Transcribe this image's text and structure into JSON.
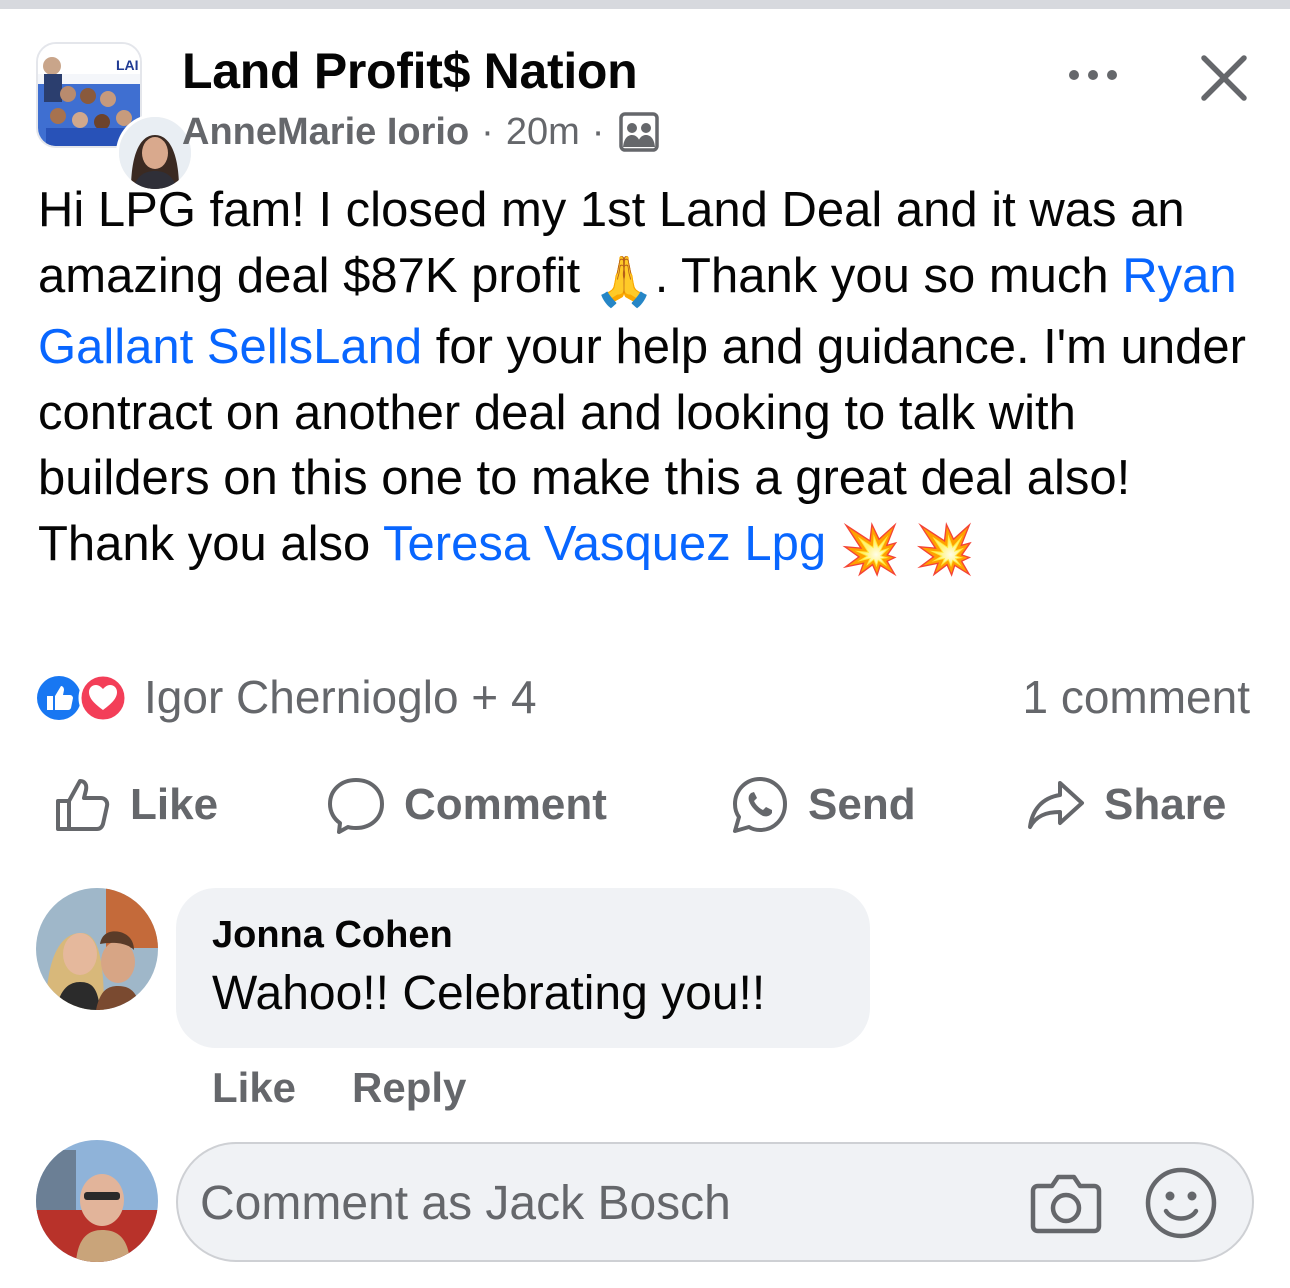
{
  "post": {
    "group_name": "Land Profit$ Nation",
    "author": "AnneMarie Iorio",
    "time": "20m",
    "separator": "·",
    "text_parts": {
      "p1": "Hi LPG fam! I closed my 1st Land Deal and it was an amazing deal $87K profit ",
      "p1_emoji": "🙏",
      "p2": ".  Thank you so much ",
      "mention1": "Ryan Gallant SellsLand",
      "p3": " for your help and guidance.  I'm under contract on another deal and looking to talk with builders on this one to make this a great deal also! Thank you also ",
      "mention2": "Teresa Vasquez Lpg",
      "p4_emoji": "💥"
    }
  },
  "reactions": {
    "summary": "Igor Chernioglo + 4",
    "comment_count": "1 comment"
  },
  "actions": {
    "like": "Like",
    "comment": "Comment",
    "send": "Send",
    "share": "Share"
  },
  "comments": [
    {
      "author": "Jonna Cohen",
      "text": "Wahoo!! Celebrating you!!",
      "like_label": "Like",
      "reply_label": "Reply"
    }
  ],
  "composer": {
    "placeholder": "Comment as Jack Bosch"
  },
  "colors": {
    "link": "#0866ff",
    "secondary_text": "#65676b",
    "bubble": "#f0f2f5",
    "like_blue": "#1877f2",
    "love_red": "#f33e58"
  }
}
